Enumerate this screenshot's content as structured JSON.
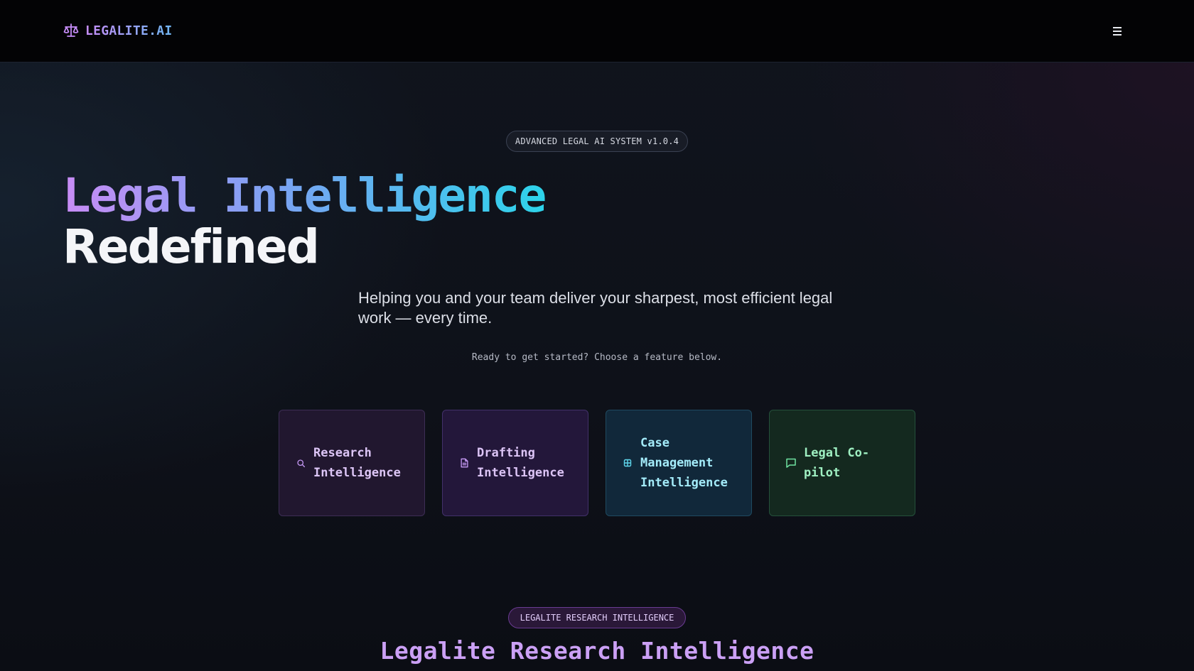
{
  "header": {
    "brand": "LEGALITE.AI",
    "brand_icon": "scales-icon",
    "menu_icon": "hamburger-menu-icon"
  },
  "hero": {
    "badge": "ADVANCED LEGAL AI SYSTEM v1.0.4",
    "title_line1": "Legal Intelligence",
    "title_line2": "Redefined",
    "subtitle": "Helping you and your team deliver your sharpest, most efficient legal work — every time.",
    "hint": "Ready to get started? Choose a feature below."
  },
  "features": [
    {
      "label": "Research Intelligence",
      "icon": "search-icon",
      "color": "#c79af6"
    },
    {
      "label": "Drafting Intelligence",
      "icon": "document-icon",
      "color": "#c79af6"
    },
    {
      "label": "Case Management Intelligence",
      "icon": "database-icon",
      "color": "#5fd6ec"
    },
    {
      "label": "Legal Co-pilot",
      "icon": "chat-icon",
      "color": "#6fe3a1"
    }
  ],
  "section": {
    "badge": "LEGALITE RESEARCH INTELLIGENCE",
    "title": "Legalite Research Intelligence"
  }
}
